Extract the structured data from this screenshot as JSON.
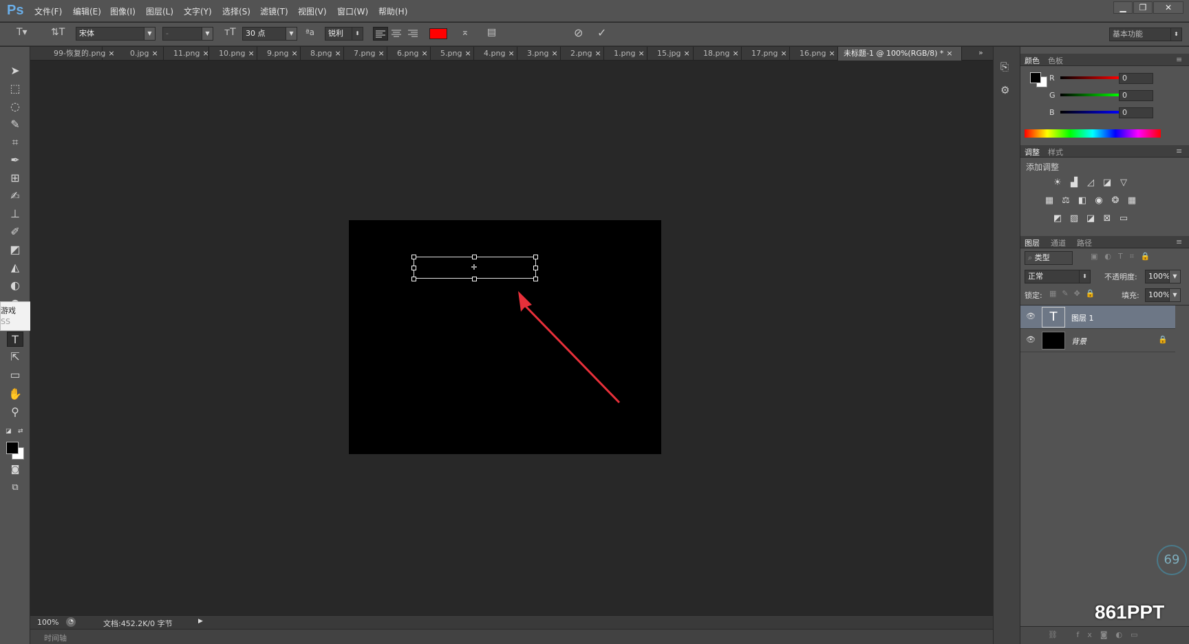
{
  "app": {
    "logo": "Ps"
  },
  "menu": [
    "文件(F)",
    "编辑(E)",
    "图像(I)",
    "图层(L)",
    "文字(Y)",
    "选择(S)",
    "滤镜(T)",
    "视图(V)",
    "窗口(W)",
    "帮助(H)"
  ],
  "window_controls": {
    "minimize": "▁",
    "restore": "❐",
    "close": "✕"
  },
  "options": {
    "font_family": "宋体",
    "font_style": "-",
    "font_size": "30 点",
    "antialias_icon": "ªa",
    "antialias": "锐利",
    "text_color": "#ff0000",
    "workspace": "基本功能"
  },
  "tabs": [
    "99-恢复的.png",
    "0.jpg",
    "11.png",
    "10.png",
    "9.png",
    "8.png",
    "7.png",
    "6.png",
    "5.png",
    "4.png",
    "3.png",
    "2.png",
    "1.png",
    "15.jpg",
    "18.png",
    "17.png",
    "16.png",
    "未标题-1 @ 100%(RGB/8) *"
  ],
  "tooltip": {
    "line1": "游戏",
    "line2": "SS"
  },
  "status": {
    "zoom": "100%",
    "doc": "文档:452.2K/0 字节"
  },
  "timeline": "时间轴",
  "color_panel": {
    "tabs": [
      "颜色",
      "色板"
    ],
    "channels": [
      {
        "label": "R",
        "value": "0"
      },
      {
        "label": "G",
        "value": "0"
      },
      {
        "label": "B",
        "value": "0"
      }
    ]
  },
  "adjust_panel": {
    "tabs": [
      "调整",
      "样式"
    ],
    "title": "添加调整"
  },
  "layers_panel": {
    "tabs": [
      "图层",
      "通道",
      "路径"
    ],
    "filter": "类型",
    "blend": "正常",
    "opacity_label": "不透明度:",
    "opacity": "100%",
    "lock_label": "锁定:",
    "fill_label": "填充:",
    "fill": "100%",
    "layers": [
      {
        "name": "图层 1",
        "type": "text"
      },
      {
        "name": "背景",
        "type": "background"
      }
    ]
  },
  "watermark": {
    "text": "861PPT",
    "badge": "69"
  }
}
